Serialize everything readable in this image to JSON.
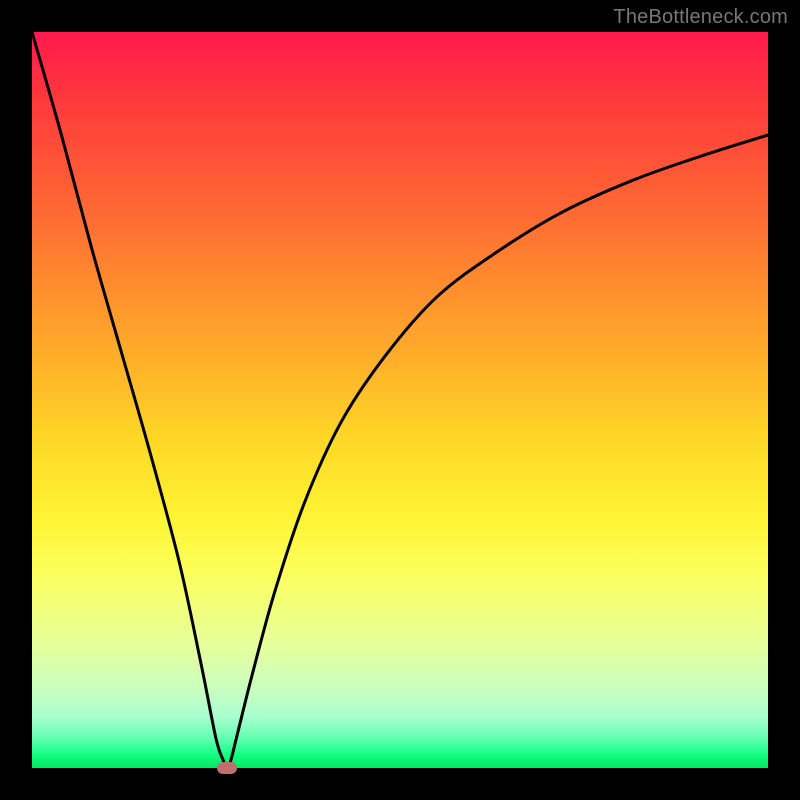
{
  "watermark": "TheBottleneck.com",
  "chart_data": {
    "type": "line",
    "title": "",
    "xlabel": "",
    "ylabel": "",
    "xlim": [
      0,
      100
    ],
    "ylim": [
      0,
      100
    ],
    "series": [
      {
        "name": "curve",
        "x": [
          0,
          4,
          8,
          12,
          16,
          20,
          23,
          25,
          26,
          26.5,
          27,
          28,
          30,
          33,
          37,
          42,
          48,
          55,
          63,
          72,
          82,
          92,
          100
        ],
        "y": [
          100,
          86,
          71,
          57,
          43,
          28,
          14,
          4,
          1,
          0,
          1,
          5,
          13,
          24,
          36,
          47,
          56,
          64,
          70,
          75.5,
          80,
          83.5,
          86
        ]
      }
    ],
    "marker": {
      "x": 26.5,
      "y": 0,
      "color": "#bf6f6f"
    },
    "gradient_stops": [
      {
        "pos": 0,
        "color": "#ff1a4d"
      },
      {
        "pos": 10,
        "color": "#ff3b3b"
      },
      {
        "pos": 25,
        "color": "#ff6b33"
      },
      {
        "pos": 35,
        "color": "#ff8f2e"
      },
      {
        "pos": 45,
        "color": "#ffb129"
      },
      {
        "pos": 55,
        "color": "#ffd626"
      },
      {
        "pos": 66,
        "color": "#fff433"
      },
      {
        "pos": 73,
        "color": "#fcff5a"
      },
      {
        "pos": 78,
        "color": "#f3ff7a"
      },
      {
        "pos": 84,
        "color": "#e3ffa0"
      },
      {
        "pos": 89,
        "color": "#caffbe"
      },
      {
        "pos": 93,
        "color": "#a9ffd0"
      },
      {
        "pos": 96,
        "color": "#62ffb0"
      },
      {
        "pos": 98,
        "color": "#19ff86"
      },
      {
        "pos": 100,
        "color": "#00e861"
      }
    ]
  }
}
